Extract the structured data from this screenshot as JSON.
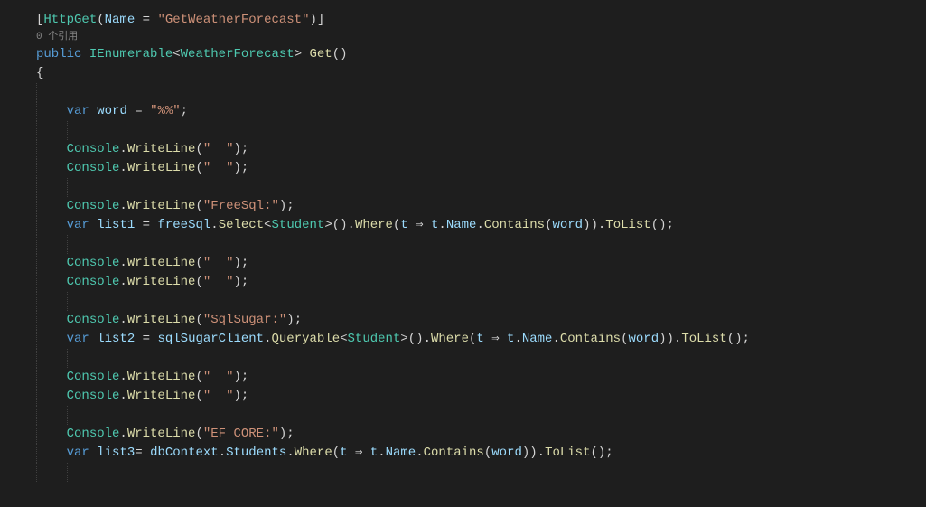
{
  "code": {
    "attribute_open": "[",
    "httpget": "HttpGet",
    "attribute_paren_open": "(",
    "name_param": "Name",
    "equals": " = ",
    "name_value": "\"GetWeatherForecast\"",
    "attribute_paren_close": ")",
    "attribute_close": "]",
    "codelens_text": "0 个引用",
    "public_kw": "public",
    "ienumerable": "IEnumerable",
    "generic_open": "<",
    "weatherforecast": "WeatherForecast",
    "generic_close": ">",
    "get_method": "Get",
    "empty_parens": "()",
    "brace_open": "{",
    "var_kw": "var",
    "word_var": "word",
    "word_value": "\"%%\"",
    "semicolon": ";",
    "console": "Console",
    "dot": ".",
    "writeline": "WriteLine",
    "empty_string": "\"  \"",
    "freesql_string": "\"FreeSql:\"",
    "list1": "list1",
    "freesql_var": "freeSql",
    "select_method": "Select",
    "student": "Student",
    "where_method": "Where",
    "t_param": "t",
    "arrow": " ⇒ ",
    "name_prop": "Name",
    "contains": "Contains",
    "tolist": "ToList",
    "sqlsugar_string": "\"SqlSugar:\"",
    "list2": "list2",
    "sqlsugar_var": "sqlSugarClient",
    "queryable": "Queryable",
    "efcore_string": "\"EF CORE:\"",
    "list3": "list3",
    "dbcontext": "dbContext",
    "students": "Students"
  }
}
